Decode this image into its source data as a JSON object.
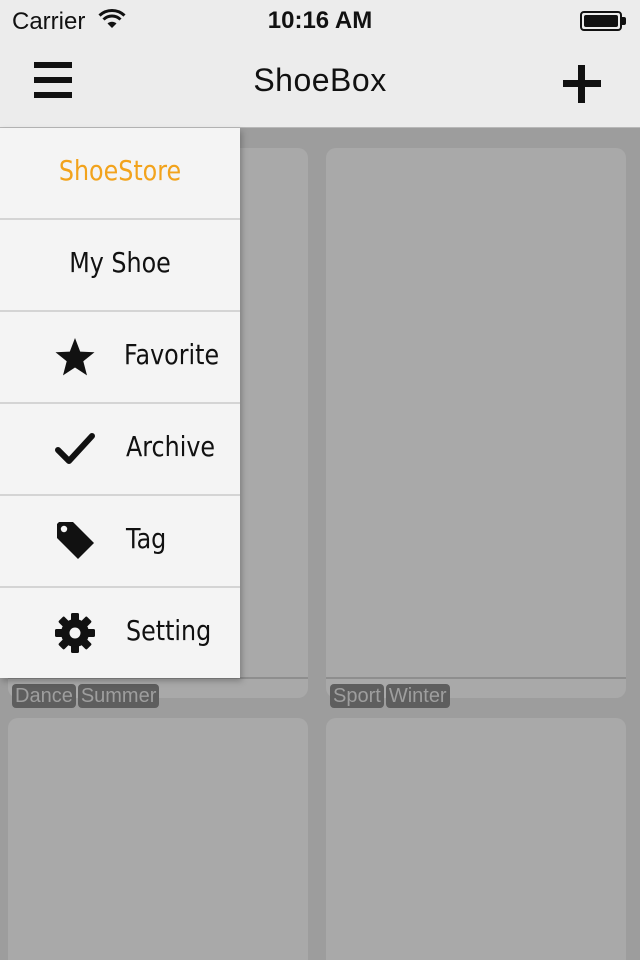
{
  "status_bar": {
    "carrier": "Carrier",
    "time": "10:16 AM"
  },
  "navbar": {
    "title": "ShoeBox"
  },
  "menu": {
    "items": [
      {
        "label": "ShoeStore",
        "icon": null,
        "active": true
      },
      {
        "label": "My Shoe",
        "icon": null,
        "active": false
      },
      {
        "label": "Favorite",
        "icon": "star-icon",
        "active": false
      },
      {
        "label": "Archive",
        "icon": "checkmark-icon",
        "active": false
      },
      {
        "label": "Tag",
        "icon": "tag-icon",
        "active": false
      },
      {
        "label": "Setting",
        "icon": "gear-icon",
        "active": false
      }
    ]
  },
  "cards": [
    {
      "tags": [
        "Dance",
        "Summer"
      ]
    },
    {
      "tags": [
        "Sport",
        "Winter"
      ]
    },
    {
      "tags": []
    },
    {
      "tags": []
    }
  ],
  "colors": {
    "accent": "#f2a31c",
    "navbar": "#ececec",
    "backdrop": "#9d9d9d",
    "card": "#a9a9a9"
  }
}
